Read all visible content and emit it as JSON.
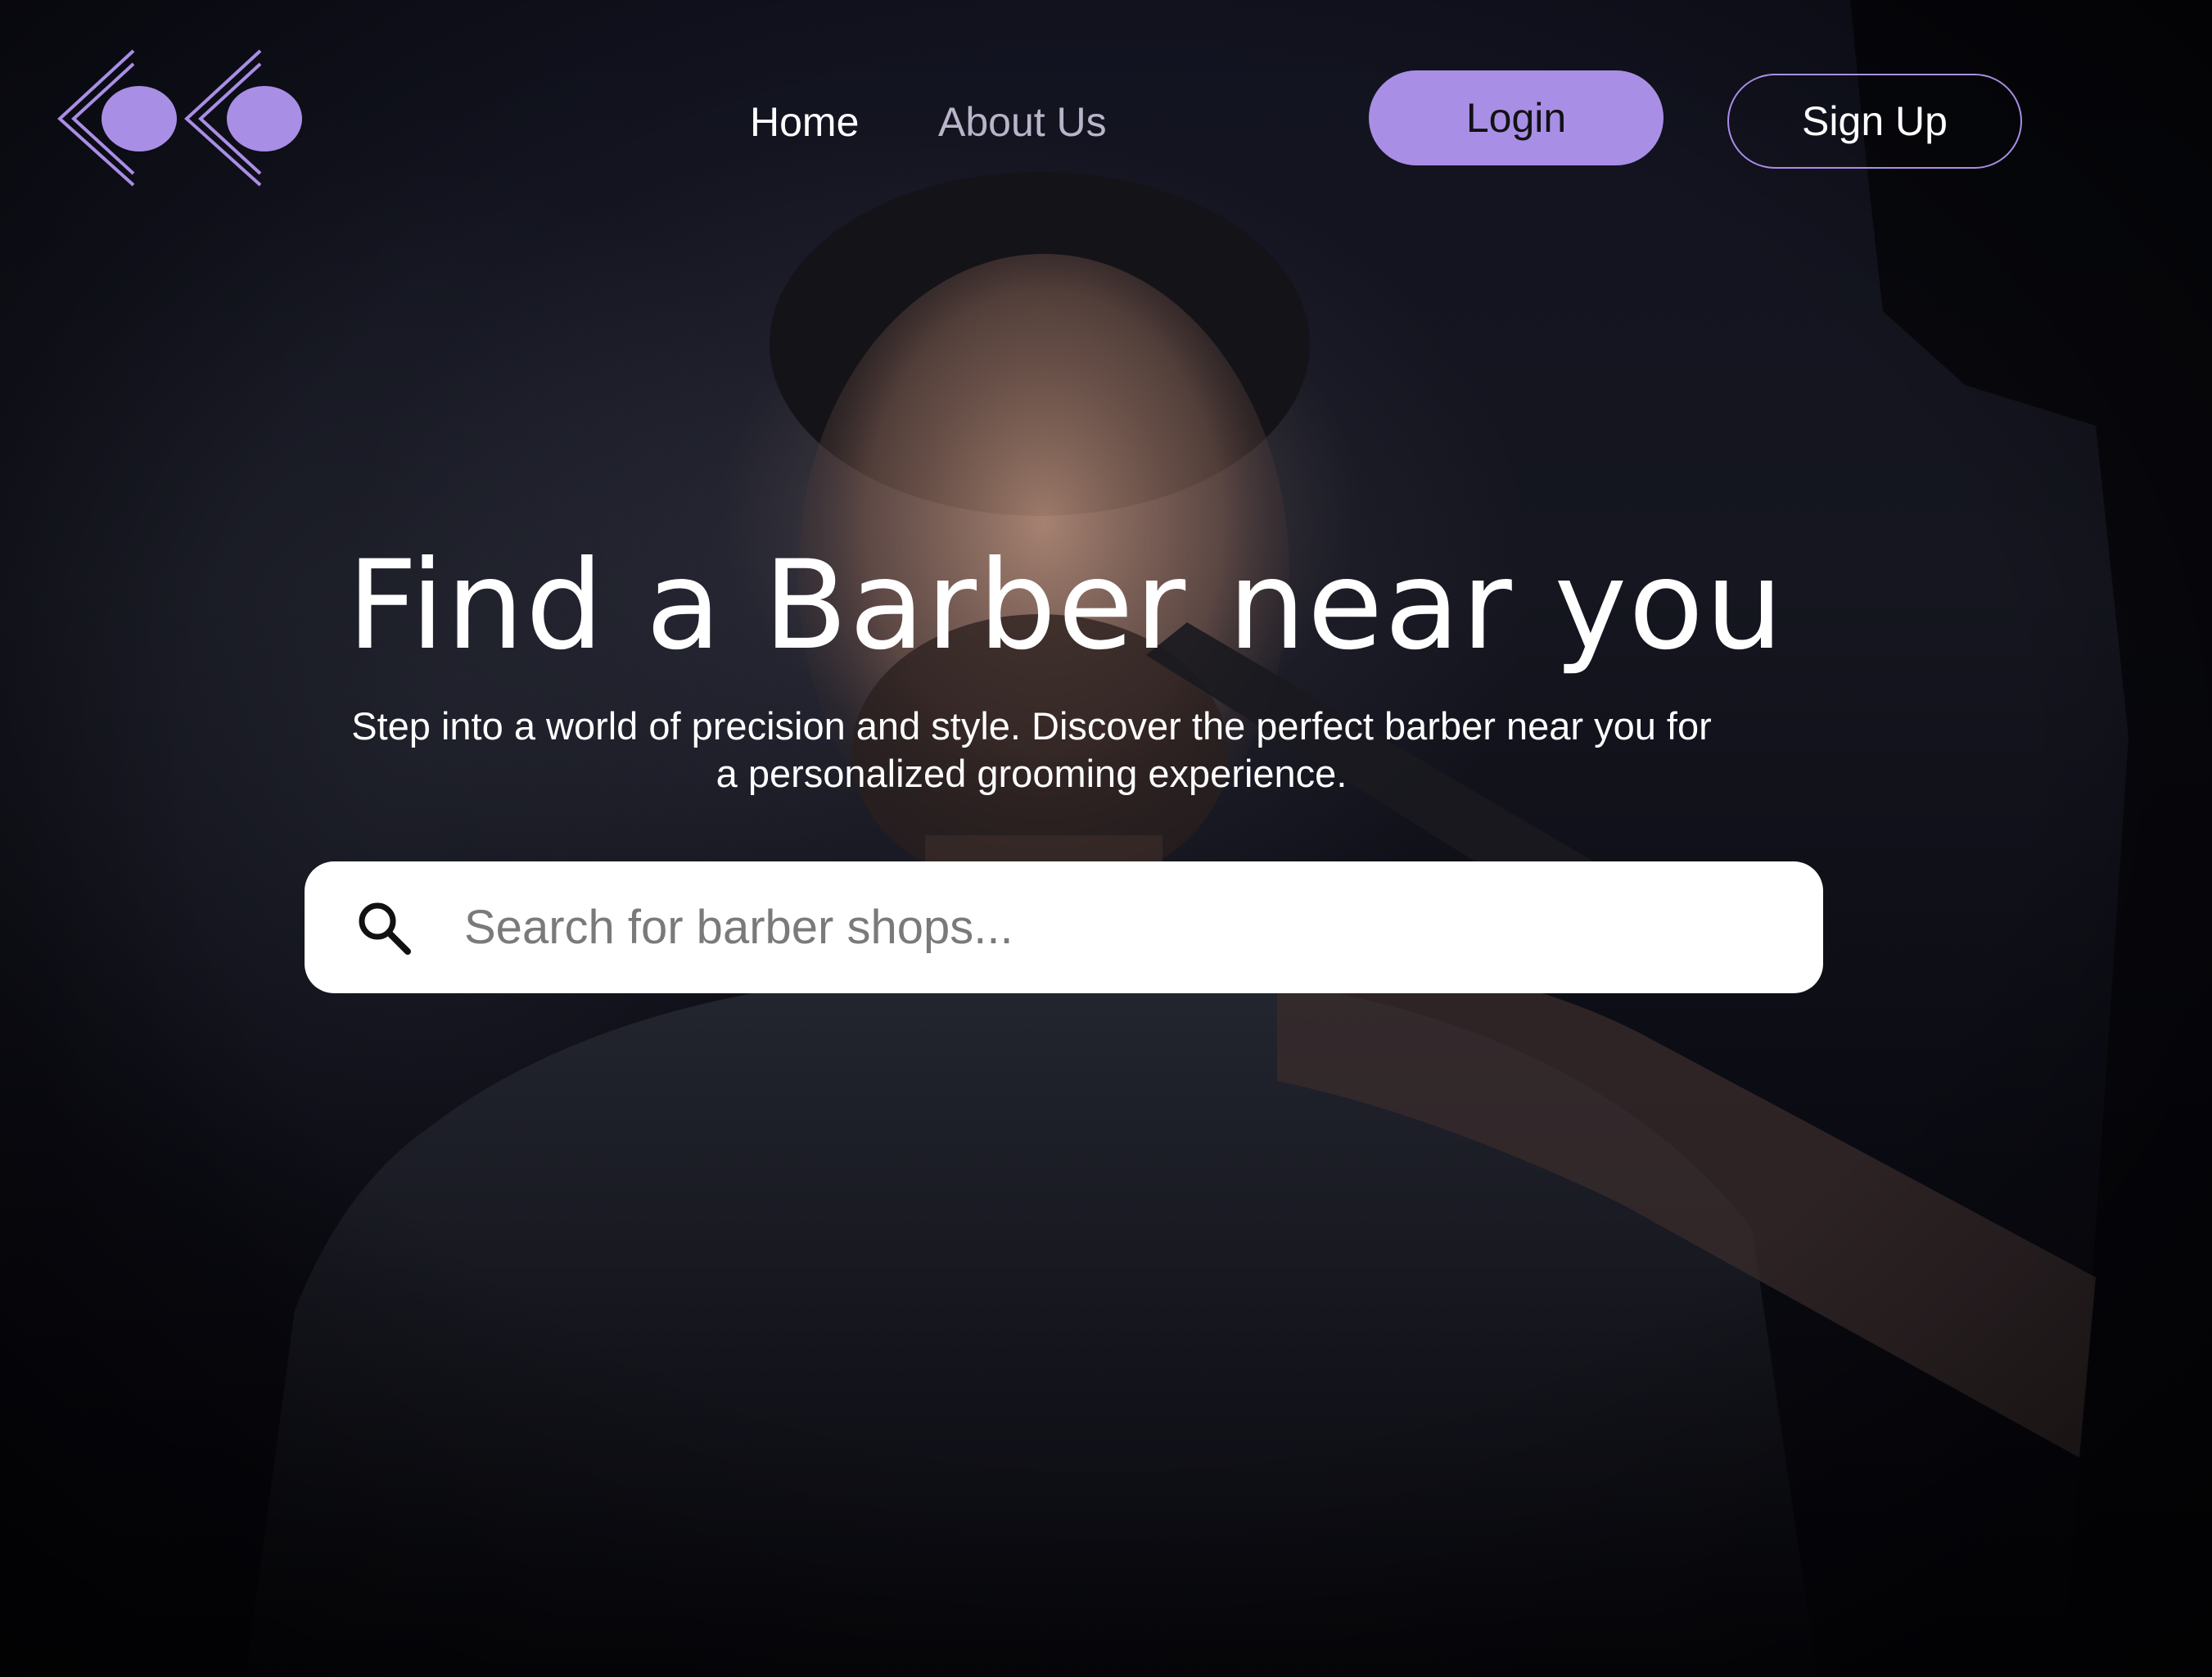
{
  "nav": {
    "home_label": "Home",
    "about_label": "About Us",
    "login_label": "Login",
    "signup_label": "Sign Up"
  },
  "hero": {
    "title": "Find a Barber near you",
    "subtitle": "Step into a world of precision and style. Discover the perfect barber near you for a personalized grooming experience."
  },
  "search": {
    "placeholder": "Search for barber shops...",
    "value": ""
  },
  "colors": {
    "accent": "#a98ee6",
    "background": "#0b0a14",
    "text": "#ffffff"
  },
  "icons": {
    "logo": "logo-icon",
    "search": "search-icon"
  }
}
